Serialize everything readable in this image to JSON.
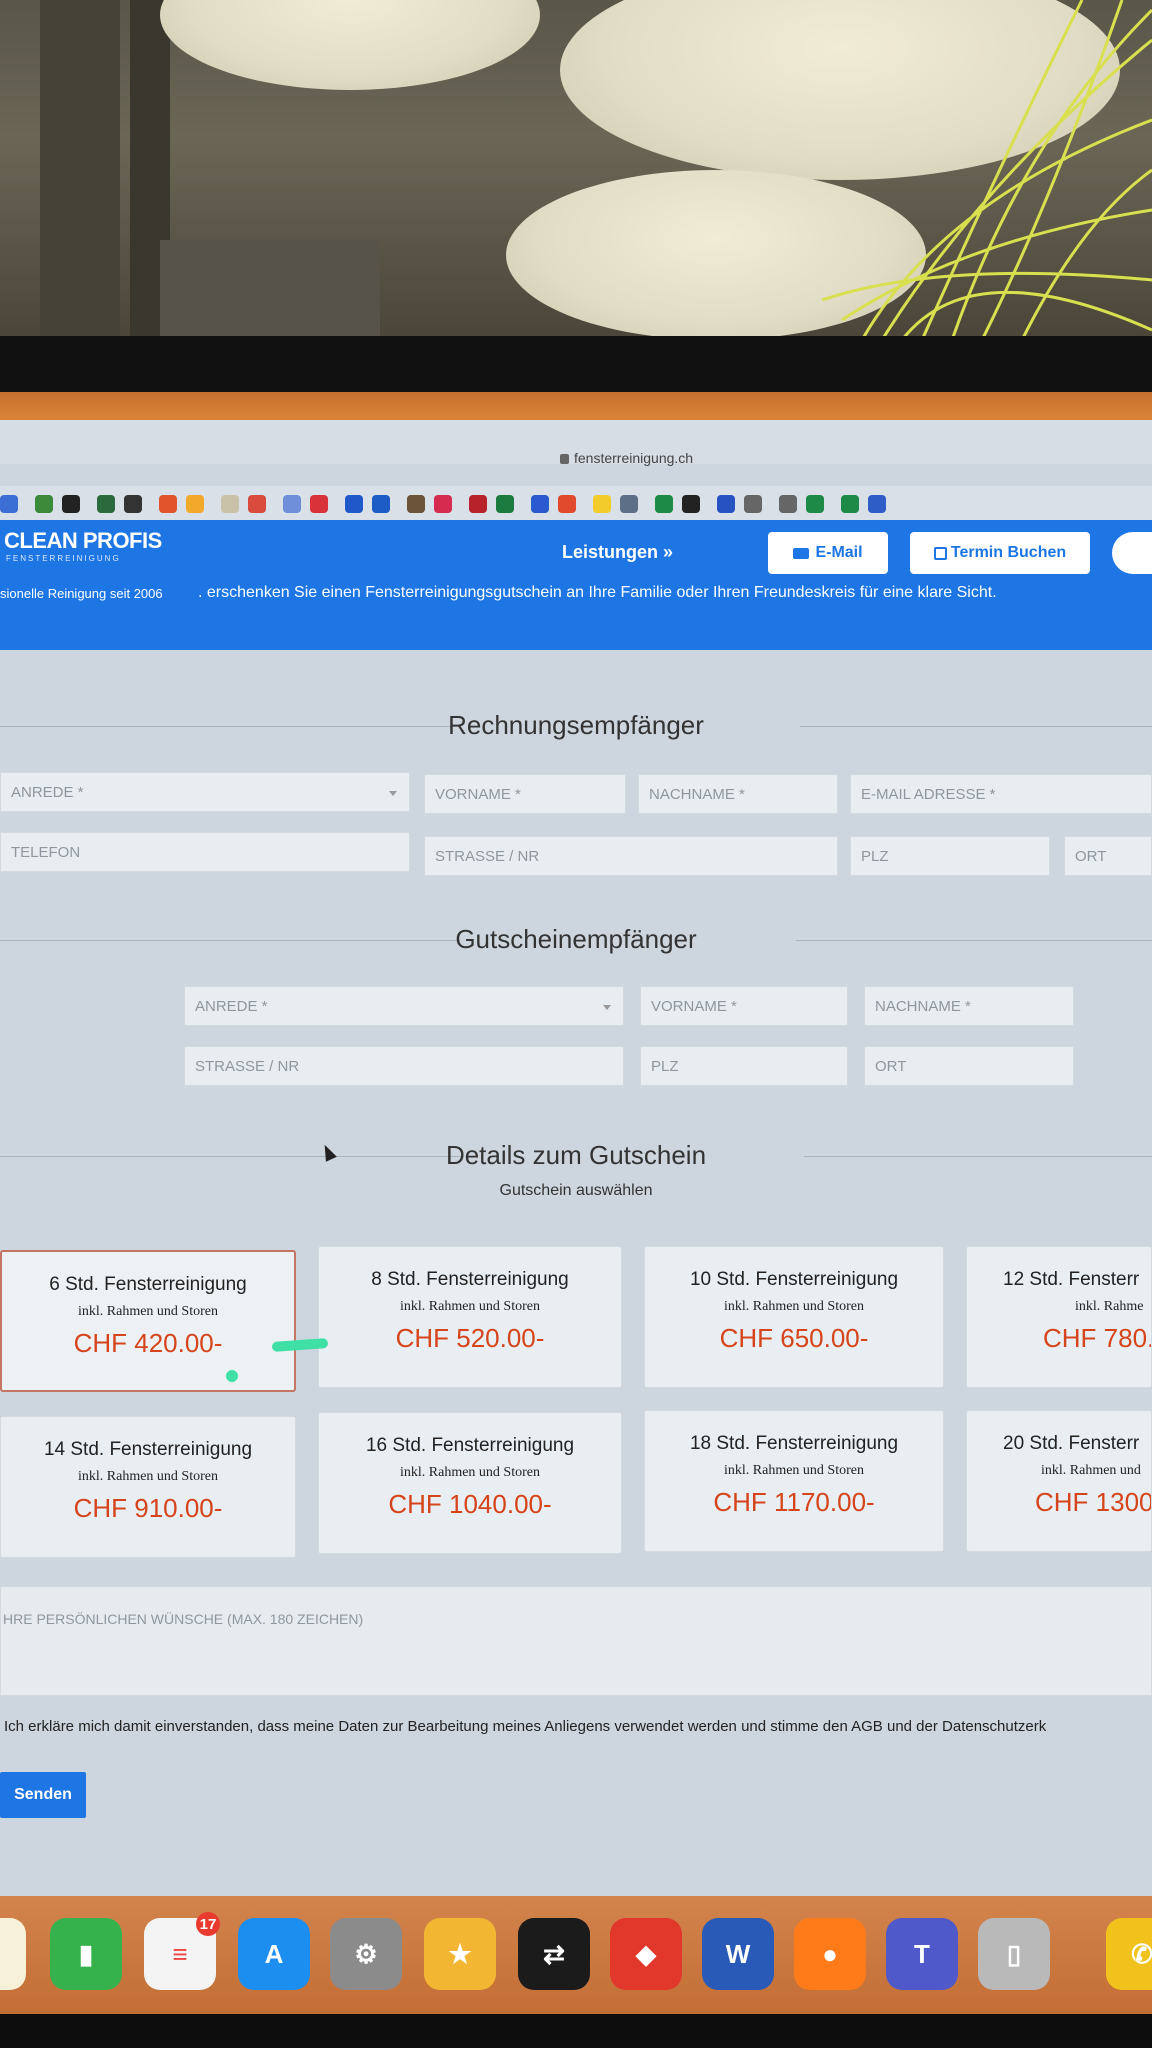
{
  "browser": {
    "url": "fensterreinigung.ch"
  },
  "header": {
    "logo": "CLEAN PROFIS",
    "logo_sub": "FENSTERREINIGUNG",
    "tagline": "sionelle Reinigung seit 2006",
    "marquee": ". erschenken Sie einen Fensterreinigungsgutschein an Ihre Familie oder Ihren Freundeskreis für eine klare Sicht.",
    "nav_leistungen": "Leistungen »",
    "email_button": "E-Mail",
    "termin_button": "Termin Buchen",
    "brand_color": "#1d76e4"
  },
  "rechnung": {
    "title": "Rechnungsempfänger",
    "anrede": "ANREDE *",
    "vorname": "VORNAME *",
    "nachname": "NACHNAME *",
    "email": "E-MAIL ADRESSE *",
    "telefon": "TELEFON",
    "strasse": "STRASSE / NR",
    "plz": "PLZ",
    "ort": "ORT"
  },
  "gutschein_empfaenger": {
    "title": "Gutscheinempfänger",
    "anrede": "ANREDE *",
    "vorname": "VORNAME *",
    "nachname": "NACHNAME *",
    "strasse": "STRASSE / NR",
    "plz": "PLZ",
    "ort": "ORT"
  },
  "details": {
    "title": "Details zum Gutschein",
    "subtitle": "Gutschein auswählen",
    "cards": [
      {
        "title": "6 Std. Fensterreinigung",
        "sub": "inkl. Rahmen und Storen",
        "price": "CHF 420.00-"
      },
      {
        "title": "8 Std. Fensterreinigung",
        "sub": "inkl. Rahmen und Storen",
        "price": "CHF 520.00-"
      },
      {
        "title": "10 Std. Fensterreinigung",
        "sub": "inkl. Rahmen und Storen",
        "price": "CHF 650.00-"
      },
      {
        "title": "12 Std. Fensterr",
        "sub": "inkl. Rahme",
        "price": "CHF 780."
      },
      {
        "title": "14 Std. Fensterreinigung",
        "sub": "inkl. Rahmen und Storen",
        "price": "CHF 910.00-"
      },
      {
        "title": "16 Std. Fensterreinigung",
        "sub": "inkl. Rahmen und Storen",
        "price": "CHF 1040.00-"
      },
      {
        "title": "18 Std. Fensterreinigung",
        "sub": "inkl. Rahmen und Storen",
        "price": "CHF 1170.00-"
      },
      {
        "title": "20 Std. Fensterr",
        "sub": "inkl. Rahmen und",
        "price": "CHF 1300"
      }
    ],
    "price_color": "#d5441a"
  },
  "wishes_placeholder": "HRE PERSÖNLICHEN WÜNSCHE (MAX. 180 ZEICHEN)",
  "consent": "Ich erkläre mich damit einverstanden, dass meine Daten zur Bearbeitung meines Anliegens verwendet werden und stimme den AGB und der Datenschutzerk",
  "submit": "Senden",
  "dock": {
    "reminders_badge": "17",
    "icons": [
      "notes-icon",
      "numbers-icon",
      "reminders-icon",
      "app-store-icon",
      "system-settings-icon",
      "superstar-icon",
      "teamviewer-icon",
      "anydesk-icon",
      "word-icon",
      "firefox-icon",
      "teams-icon",
      "iphone-mirroring-icon",
      "whatsapp-icon"
    ]
  }
}
